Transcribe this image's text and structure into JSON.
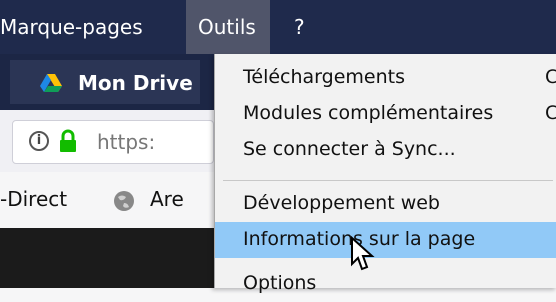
{
  "menubar": {
    "items": [
      {
        "label": "Marque-pages"
      },
      {
        "label": "Outils"
      },
      {
        "label": "?"
      }
    ]
  },
  "toolbar": {
    "tab_label": "Mon Drive"
  },
  "urlbar": {
    "value": "https:"
  },
  "bookmarks": {
    "items": [
      {
        "label": "-Direct"
      },
      {
        "label": "Are"
      }
    ]
  },
  "menu": {
    "items": [
      {
        "label": "Téléchargements",
        "shortcut": "C"
      },
      {
        "label": "Modules complémentaires",
        "shortcut": "C"
      },
      {
        "label": "Se connecter à Sync..."
      },
      {
        "label": "Développement web"
      },
      {
        "label": "Informations sur la page"
      },
      {
        "label": "Options"
      }
    ]
  },
  "colors": {
    "menubar_bg": "#1f2a4c",
    "active_menu_bg": "#50556a",
    "highlight": "#91c9f7",
    "lock_green": "#12bc00"
  }
}
